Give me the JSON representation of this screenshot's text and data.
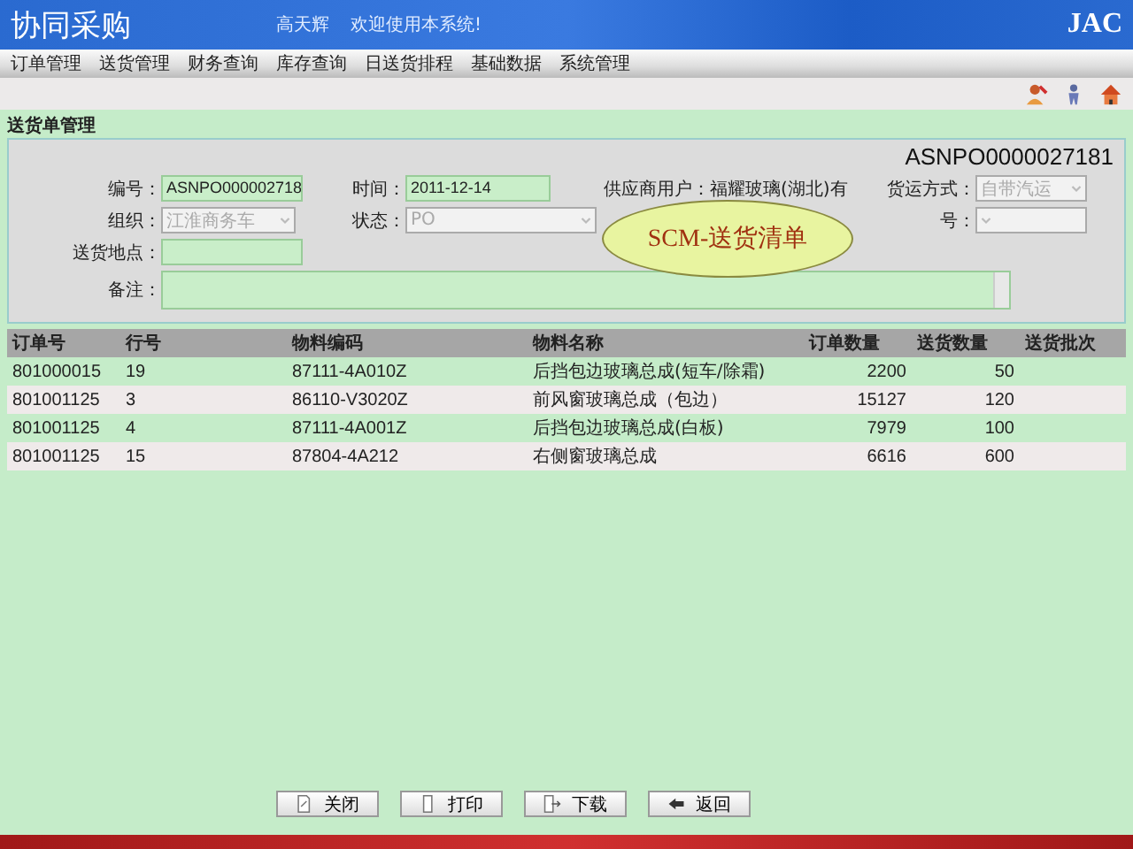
{
  "app": {
    "title": "协同采购",
    "user": "高天辉",
    "welcome": "欢迎使用本系统!",
    "brand": "JAC"
  },
  "menu": [
    "订单管理",
    "送货管理",
    "财务查询",
    "库存查询",
    "日送货排程",
    "基础数据",
    "系统管理"
  ],
  "section_title": "送货单管理",
  "form": {
    "doc_number": "ASNPO0000027181",
    "rows": [
      [
        {
          "kind": "input",
          "label": "编号：",
          "value": "ASNPO000002718"
        },
        {
          "kind": "input",
          "label": "时间：",
          "value": "2011-12-14"
        },
        {
          "kind": "text",
          "label": "供应商用户：",
          "value": "福耀玻璃(湖北)有"
        },
        {
          "kind": "select",
          "label": "货运方式：",
          "value": "自带汽运",
          "disabled": true
        }
      ],
      [
        {
          "kind": "select",
          "label": "组织：",
          "value": "江淮商务车",
          "disabled": true
        },
        {
          "kind": "select",
          "label": "状态：",
          "value": "PO",
          "disabled": true
        },
        {
          "kind": "blank"
        },
        {
          "kind": "select",
          "label": "号：",
          "disabled": true
        }
      ],
      [
        {
          "kind": "input",
          "label": "送货地点："
        }
      ],
      [
        {
          "kind": "textarea",
          "label": "备注："
        }
      ]
    ]
  },
  "overlay_label": "SCM-送货清单",
  "table": {
    "columns": [
      "订单号",
      "行号",
      "物料编码",
      "物料名称",
      "订单数量",
      "送货数量",
      "送货批次"
    ],
    "rows": [
      [
        "801000015",
        "19",
        "87111-4A010Z",
        "后挡包边玻璃总成(短车/除霜)",
        "2200",
        "50"
      ],
      [
        "801001125",
        "3",
        "86110-V3020Z",
        "前风窗玻璃总成（包边）",
        "15127",
        "120"
      ],
      [
        "801001125",
        "4",
        "87111-4A001Z",
        "后挡包边玻璃总成(白板)",
        "7979",
        "100"
      ],
      [
        "801001125",
        "15",
        "87804-4A212",
        "右侧窗玻璃总成",
        "6616",
        "600"
      ]
    ]
  },
  "buttons": [
    {
      "kind": "close",
      "label": "关闭"
    },
    {
      "kind": "print",
      "label": "打印"
    },
    {
      "kind": "download",
      "label": "下载"
    },
    {
      "kind": "back",
      "label": "返回"
    }
  ]
}
